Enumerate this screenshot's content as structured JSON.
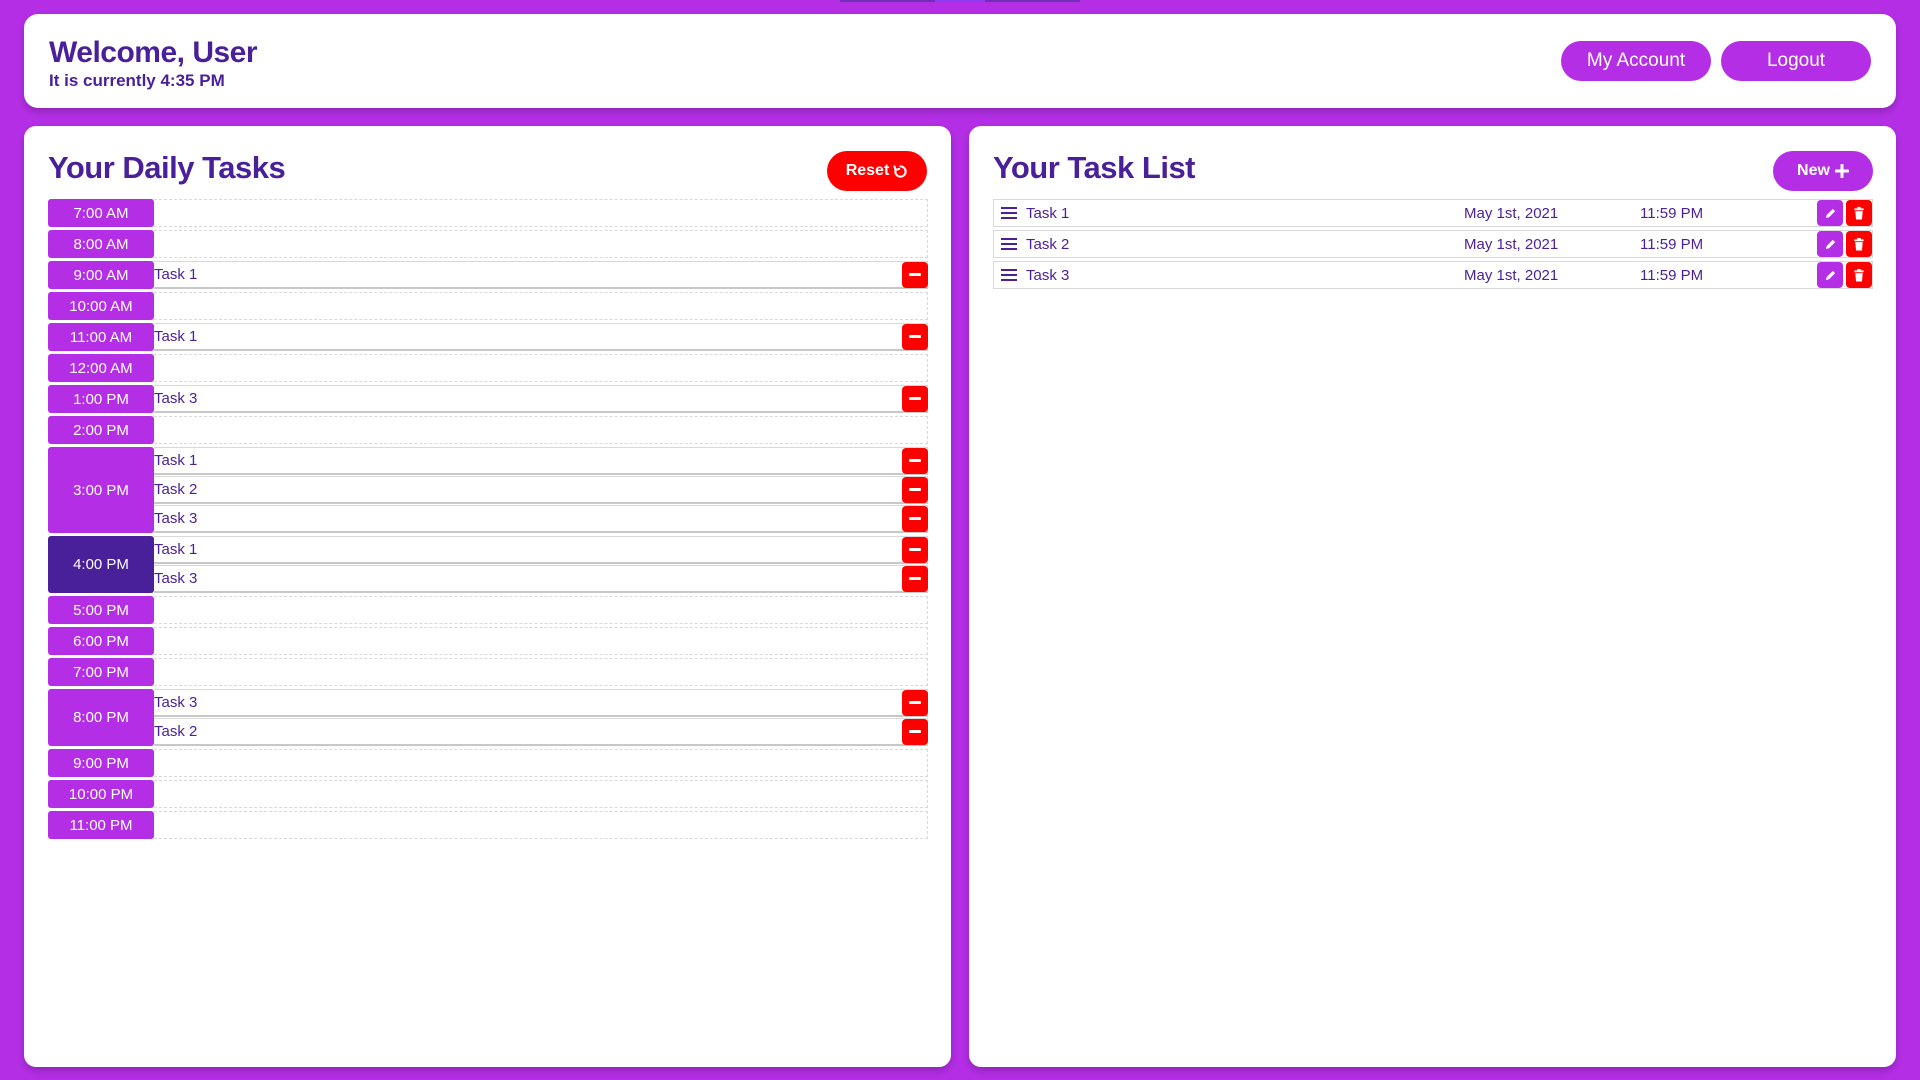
{
  "header": {
    "welcome": "Welcome, User",
    "clock_text": "It is currently 4:35 PM",
    "account_label": "My Account",
    "logout_label": "Logout"
  },
  "daily": {
    "title": "Your Daily Tasks",
    "reset_label": "Reset",
    "reset_icon": "refresh-icon",
    "remove_icon": "minus-icon",
    "current_hour": "4:00 PM",
    "slots": [
      {
        "time": "7:00 AM",
        "tasks": []
      },
      {
        "time": "8:00 AM",
        "tasks": []
      },
      {
        "time": "9:00 AM",
        "tasks": [
          "Task 1"
        ]
      },
      {
        "time": "10:00 AM",
        "tasks": []
      },
      {
        "time": "11:00 AM",
        "tasks": [
          "Task 1"
        ]
      },
      {
        "time": "12:00 AM",
        "tasks": []
      },
      {
        "time": "1:00 PM",
        "tasks": [
          "Task 3"
        ]
      },
      {
        "time": "2:00 PM",
        "tasks": []
      },
      {
        "time": "3:00 PM",
        "tasks": [
          "Task 1",
          "Task 2",
          "Task 3"
        ]
      },
      {
        "time": "4:00 PM",
        "tasks": [
          "Task 1",
          "Task 3"
        ]
      },
      {
        "time": "5:00 PM",
        "tasks": []
      },
      {
        "time": "6:00 PM",
        "tasks": []
      },
      {
        "time": "7:00 PM",
        "tasks": []
      },
      {
        "time": "8:00 PM",
        "tasks": [
          "Task 3",
          "Task 2"
        ]
      },
      {
        "time": "9:00 PM",
        "tasks": []
      },
      {
        "time": "10:00 PM",
        "tasks": []
      },
      {
        "time": "11:00 PM",
        "tasks": []
      }
    ]
  },
  "tasklist": {
    "title": "Your Task List",
    "new_label": "New",
    "new_icon": "plus-icon",
    "row_icons": {
      "drag": "drag-handle-icon",
      "edit": "pencil-icon",
      "delete": "trash-icon"
    },
    "tasks": [
      {
        "name": "Task 1",
        "date": "May 1st, 2021",
        "time": "11:59 PM"
      },
      {
        "name": "Task 2",
        "date": "May 1st, 2021",
        "time": "11:59 PM"
      },
      {
        "name": "Task 3",
        "date": "May 1st, 2021",
        "time": "11:59 PM"
      }
    ]
  },
  "colors": {
    "background": "#b42ee6",
    "primary": "#b42ee6",
    "heading": "#4a1f9a",
    "current_hour": "#4a1f9a",
    "danger": "#ff0000"
  }
}
